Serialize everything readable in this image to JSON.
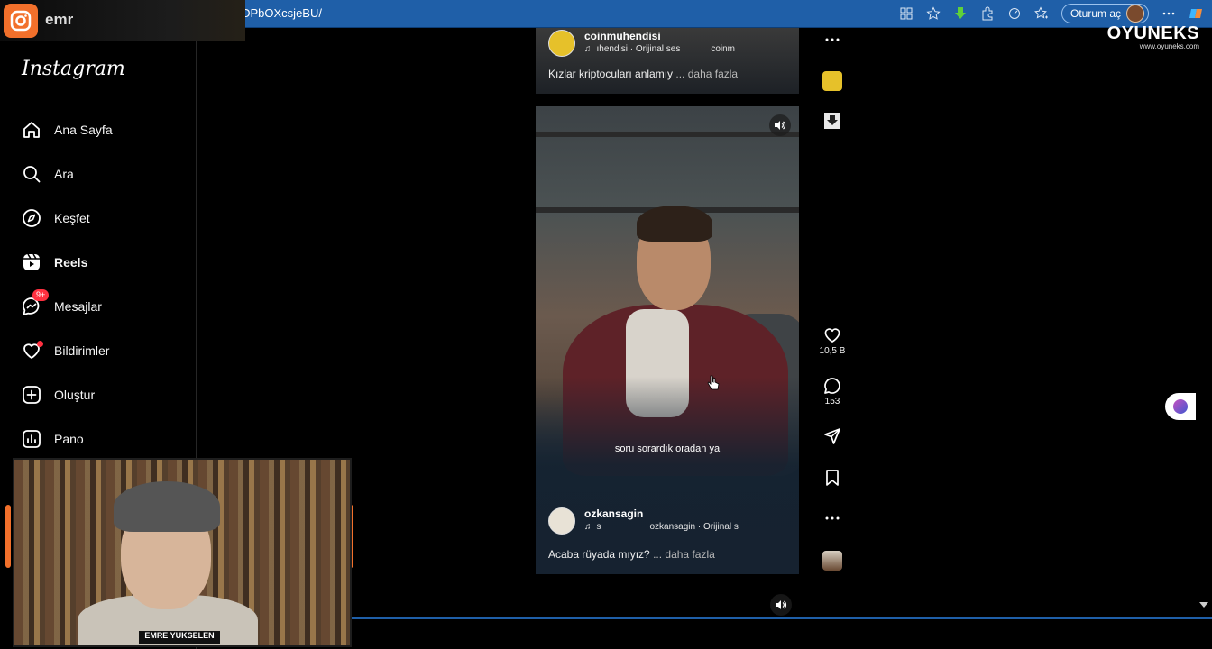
{
  "browser": {
    "url_fragment": "s/DPbOXcsjeBU/",
    "signin_label": "Oturum aç"
  },
  "stream": {
    "channel_short": "emr",
    "webcam_name": "EMRE YUKSELEN",
    "watermark_brand": "OYUNEKS",
    "watermark_site": "www.oyuneks.com",
    "accent_color": "#f2702b"
  },
  "sidebar": {
    "logo": "Instagram",
    "items": [
      {
        "label": "Ana Sayfa",
        "icon": "home-icon"
      },
      {
        "label": "Ara",
        "icon": "search-icon"
      },
      {
        "label": "Keşfet",
        "icon": "explore-icon"
      },
      {
        "label": "Reels",
        "icon": "reels-icon",
        "active": true
      },
      {
        "label": "Mesajlar",
        "icon": "messenger-icon",
        "badge": "9+"
      },
      {
        "label": "Bildirimler",
        "icon": "heart-icon",
        "dot": true
      },
      {
        "label": "Oluştur",
        "icon": "plus-square-icon"
      },
      {
        "label": "Pano",
        "icon": "dashboard-icon"
      }
    ]
  },
  "reels": {
    "previous": {
      "username": "coinmuhendisi",
      "audio_left": "ıhendisi · Orijinal ses",
      "audio_right": "coinm",
      "caption": "Kızlar kriptocuları anlamıy",
      "more": "... daha fazla"
    },
    "current": {
      "subtitle": "soru sorardık oradan ya",
      "username": "ozkansagin",
      "audio_left": "s",
      "audio_right": "ozkansagin · Orijinal s",
      "caption": "Acaba rüyada mıyız?",
      "more": "... daha fazla",
      "likes": "10,5 B",
      "comments": "153"
    }
  }
}
